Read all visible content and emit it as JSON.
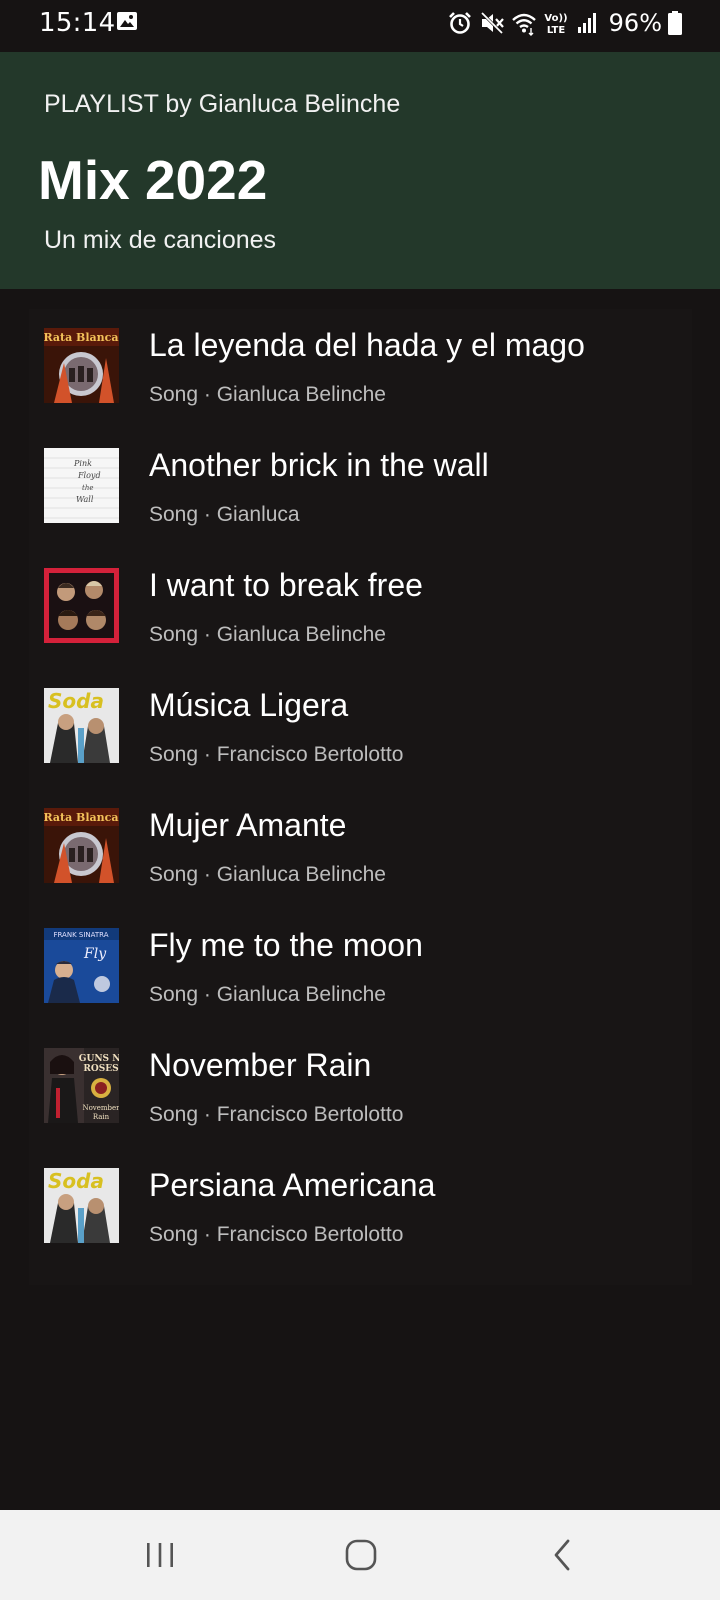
{
  "status_bar": {
    "time": "15:14",
    "battery": "96%",
    "icons": [
      "image-icon",
      "alarm-icon",
      "mute-icon",
      "wifi-icon",
      "volte-icon",
      "signal-icon",
      "battery-icon"
    ]
  },
  "playlist": {
    "by_line": "PLAYLIST by Gianluca Belinche",
    "title": "Mix 2022",
    "description": "Un mix de canciones"
  },
  "songs": [
    {
      "title": "La leyenda del hada y el mago",
      "subtitle": "Song · Gianluca Belinche",
      "cover": "rata-blanca"
    },
    {
      "title": "Another brick in the wall",
      "subtitle": "Song · Gianluca",
      "cover": "pink-floyd"
    },
    {
      "title": "I want to break free",
      "subtitle": "Song · Gianluca Belinche",
      "cover": "queen"
    },
    {
      "title": "Música Ligera",
      "subtitle": "Song · Francisco Bertolotto",
      "cover": "soda-stereo"
    },
    {
      "title": "Mujer Amante",
      "subtitle": "Song · Gianluca Belinche",
      "cover": "rata-blanca"
    },
    {
      "title": "Fly me to the moon",
      "subtitle": "Song · Gianluca Belinche",
      "cover": "sinatra"
    },
    {
      "title": "November Rain",
      "subtitle": "Song · Francisco Bertolotto",
      "cover": "guns-n-roses"
    },
    {
      "title": "Persiana Americana",
      "subtitle": "Song · Francisco Bertolotto",
      "cover": "soda-stereo"
    }
  ],
  "colors": {
    "background": "#161313",
    "header": "#23382a",
    "list": "#181515",
    "subtitle_text": "#bdbdbd",
    "nav_bar": "#f2f2f2"
  },
  "nav_bar": {
    "buttons": [
      "recent-apps-icon",
      "home-icon",
      "back-icon"
    ]
  }
}
